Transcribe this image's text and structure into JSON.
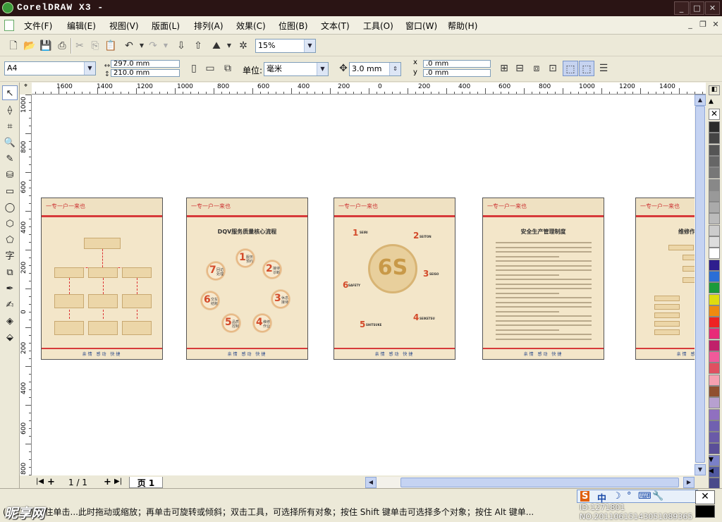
{
  "window": {
    "title": "CorelDRAW X3 -"
  },
  "menu": [
    "文件(F)",
    "编辑(E)",
    "视图(V)",
    "版面(L)",
    "排列(A)",
    "效果(C)",
    "位图(B)",
    "文本(T)",
    "工具(O)",
    "窗口(W)",
    "帮助(H)"
  ],
  "toolbar": {
    "zoom": "15%"
  },
  "property_bar": {
    "paper": "A4",
    "width": "297.0 mm",
    "height": "210.0 mm",
    "units_label": "单位:",
    "units": "毫米",
    "nudge": "3.0 mm",
    "dup_x": ".0 mm",
    "dup_y": ".0 mm",
    "x_label": "x",
    "y_label": "y"
  },
  "ruler": {
    "h_ticks": [
      "1600",
      "1400",
      "1200",
      "1000",
      "800",
      "600",
      "400",
      "200",
      "0",
      "200",
      "400",
      "600",
      "800",
      "1000",
      "1200",
      "1400"
    ],
    "v_ticks": [
      "1000",
      "800",
      "600",
      "400",
      "200",
      "0",
      "200",
      "400",
      "600",
      "800"
    ]
  },
  "pages_bar": {
    "count": "1 / 1",
    "tab": "页 1"
  },
  "artboards": {
    "logo": "一专一户一来也",
    "footer": "亲情  感动  快捷",
    "page2_title": "DQV服务质量核心流程",
    "page2_steps": [
      {
        "n": "1",
        "t": "服务预约"
      },
      {
        "n": "2",
        "t": "接待诊断"
      },
      {
        "n": "3",
        "t": "休息接待"
      },
      {
        "n": "4",
        "t": "维修作业"
      },
      {
        "n": "5",
        "t": "品质控制"
      },
      {
        "n": "6",
        "t": "交车结账"
      },
      {
        "n": "7",
        "t": "回访处理"
      }
    ],
    "page3_center": "6S",
    "page3_items": [
      {
        "n": "1",
        "t": "SEIRI"
      },
      {
        "n": "2",
        "t": "SEITON"
      },
      {
        "n": "3",
        "t": "SEISO"
      },
      {
        "n": "4",
        "t": "SEIKETSU"
      },
      {
        "n": "5",
        "t": "SHITSUKE"
      },
      {
        "n": "6",
        "t": "SAFETY"
      }
    ],
    "page4_title": "安全生产管理制度",
    "page5_title": "维修作"
  },
  "status": {
    "text": "(5 ... 3)  按住单击...此时拖动或缩放；再单击可旋转或倾斜；双击工具，可选择所有对象；按住 Shift 键单击可选择多个对象；按住 Alt 键单...",
    "watermark": "昵享网",
    "serial": "ID:1271801 NO:20110615143051089365",
    "ime": [
      "S",
      "中",
      "☽",
      "°",
      "⌨",
      "🔧"
    ]
  },
  "palette": [
    "#2b2b2b",
    "#444",
    "#555",
    "#666",
    "#777",
    "#888",
    "#999",
    "#aaa",
    "#bbb",
    "#ccc",
    "#ddd",
    "#fff",
    "#2e1e8e",
    "#2a6ed6",
    "#1b9a3a",
    "#e0dc10",
    "#f08a10",
    "#e22",
    "#e82a78",
    "#c0206a",
    "#f05a9a",
    "#e05060",
    "#f6a0b0",
    "#905030",
    "#b7a0d0",
    "#9070c0",
    "#7060b0",
    "#6a5aa8",
    "#5a4e98",
    "#7a80c8",
    "#5058a0",
    "#4a4a8a"
  ]
}
